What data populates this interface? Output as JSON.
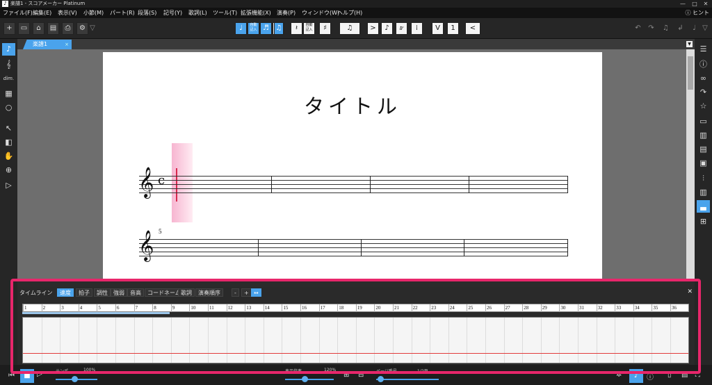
{
  "window": {
    "title": "楽譜1 - スコアメーカー Platinum",
    "min": "—",
    "max": "□",
    "close": "✕"
  },
  "menu": {
    "items": [
      "ファイル(F)",
      "編集(E)",
      "表示(V)",
      "小節(M)",
      "パート(R)",
      "段落(S)",
      "記号(Y)",
      "歌詞(L)",
      "ツール(T)",
      "拡張機能(X)",
      "演奏(P)",
      "ウィンドウ(W)",
      "ヘルプ(H)"
    ],
    "hint": "ヒント"
  },
  "toolbar": {
    "note_glyph": "♩",
    "rest_glyph": "𝄽",
    "sharp_glyph": "♯",
    "accent_glyph": ">",
    "staccato_glyph": "♪",
    "trill_glyph": "𝆖",
    "arpeggio_glyph": "⁞",
    "bow_glyph": "V",
    "tuplet_label": "1",
    "auto_label": "自動\n記入",
    "undo": "↶",
    "redo": "↷"
  },
  "document_tab": {
    "label": "楽譜1",
    "close": "×"
  },
  "score": {
    "title": "タイトル",
    "clef": "𝄞",
    "time_signature": "c",
    "system2_measure_number": "5"
  },
  "timeline": {
    "label": "タイムライン",
    "tabs": [
      "速度",
      "拍子",
      "調性",
      "強弱",
      "音高",
      "コードネーム",
      "歌詞",
      "演奏順序"
    ],
    "active_tab": "速度",
    "zoom_minus": "-",
    "zoom_plus": "+",
    "zoom_fit": "↔",
    "close": "✕",
    "measures": [
      "1",
      "2",
      "3",
      "4",
      "5",
      "6",
      "7",
      "8",
      "9",
      "10",
      "11",
      "12",
      "13",
      "14",
      "15",
      "16",
      "17",
      "18",
      "19",
      "20",
      "21",
      "22",
      "23",
      "24",
      "25",
      "26",
      "27",
      "28",
      "29",
      "30",
      "31",
      "32",
      "33",
      "34",
      "35",
      "36"
    ]
  },
  "status": {
    "tempo_label": "テンポ",
    "tempo_value": "100%",
    "zoom_label": "表示倍率",
    "zoom_value": "120%",
    "page_label": "ページ番号",
    "page_value": "1/2頁"
  },
  "colors": {
    "accent": "#4aa3ec",
    "highlight": "#e8266b",
    "tempo_line": "#e23b3b"
  }
}
